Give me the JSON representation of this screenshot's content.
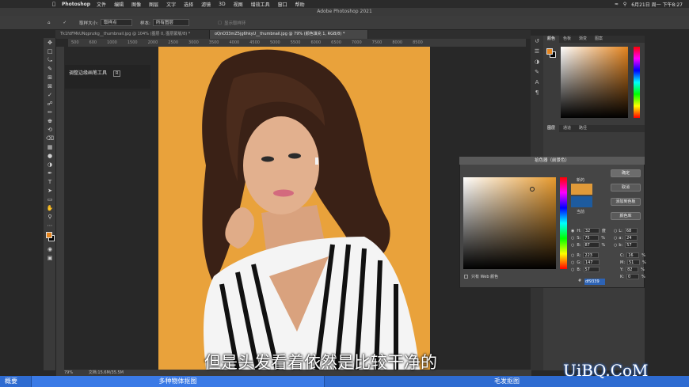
{
  "mac_menu": {
    "app": "Photoshop",
    "items": [
      "文件",
      "编辑",
      "图像",
      "图层",
      "文字",
      "选择",
      "滤镜",
      "3D",
      "视图",
      "增效工具",
      "窗口",
      "帮助"
    ],
    "clock": "6月21日 周一 下午8:27"
  },
  "window": {
    "title": "Adobe Photoshop 2021"
  },
  "options_bar": {
    "label1": "取样大小:",
    "value1": "取样点",
    "label2": "样本:",
    "value2": "所有图层",
    "hint": "显示取样环"
  },
  "tabs": [
    {
      "label": "Tk1fdFMkUNqpnzkg__thumbnail.jpg @ 104% (图层 0, 图层蒙版/8) *",
      "active": false
    },
    {
      "label": "oQnO33mZ5jg6hkyU__thumbnail.jpg @ 79% (颜色填充 1, RGB/8) *",
      "active": true
    }
  ],
  "ruler_ticks": [
    "500",
    "600",
    "1000",
    "1500",
    "2000",
    "2500",
    "3000",
    "3500",
    "4000",
    "4500",
    "5000",
    "5500",
    "6000",
    "6500",
    "7000",
    "7500",
    "8000",
    "8500"
  ],
  "tooltip": {
    "text": "调整边缘画笔工具",
    "shortcut": "R"
  },
  "right_panels": {
    "color_tabs": [
      "颜色",
      "色板",
      "渐变",
      "图案"
    ],
    "lower_tabs": [
      "图层",
      "通道",
      "路径"
    ]
  },
  "color_picker": {
    "title": "拾色器（前景色）",
    "new_label": "新的",
    "current_label": "当前",
    "ok": "确定",
    "cancel": "取消",
    "add_swatch": "添加到色板",
    "libraries": "颜色库",
    "web_only": "只有 Web 颜色",
    "hsb": [
      {
        "k": "H:",
        "v": "32",
        "u": "度"
      },
      {
        "k": "S:",
        "v": "75",
        "u": "%"
      },
      {
        "k": "B:",
        "v": "87",
        "u": "%"
      }
    ],
    "rgb": [
      {
        "k": "R:",
        "v": "223"
      },
      {
        "k": "G:",
        "v": "147"
      },
      {
        "k": "B:",
        "v": "57"
      }
    ],
    "lab": [
      {
        "k": "L:",
        "v": "68"
      },
      {
        "k": "a:",
        "v": "24"
      },
      {
        "k": "b:",
        "v": "57"
      }
    ],
    "cmyk": [
      {
        "k": "C:",
        "v": "16",
        "u": "%"
      },
      {
        "k": "M:",
        "v": "51",
        "u": "%"
      },
      {
        "k": "Y:",
        "v": "82",
        "u": "%"
      },
      {
        "k": "K:",
        "v": "0",
        "u": "%"
      }
    ],
    "hex_label": "#",
    "hex": "df9339",
    "new_color": "#e09a39",
    "current_color": "#1d5b9f"
  },
  "status": {
    "zoom": "79%",
    "doc": "文档:15.6M/35.5M"
  },
  "bottom_bar": {
    "left": "概要",
    "middle": "多种物体抠图",
    "right": "毛发抠图"
  },
  "subtitle": "但是头发看着依然是比较干净的",
  "watermark": "UiBQ.CoM",
  "colors": {
    "canvas_bg": "#e9a23b",
    "accent_blue": "#2e6bd1"
  }
}
